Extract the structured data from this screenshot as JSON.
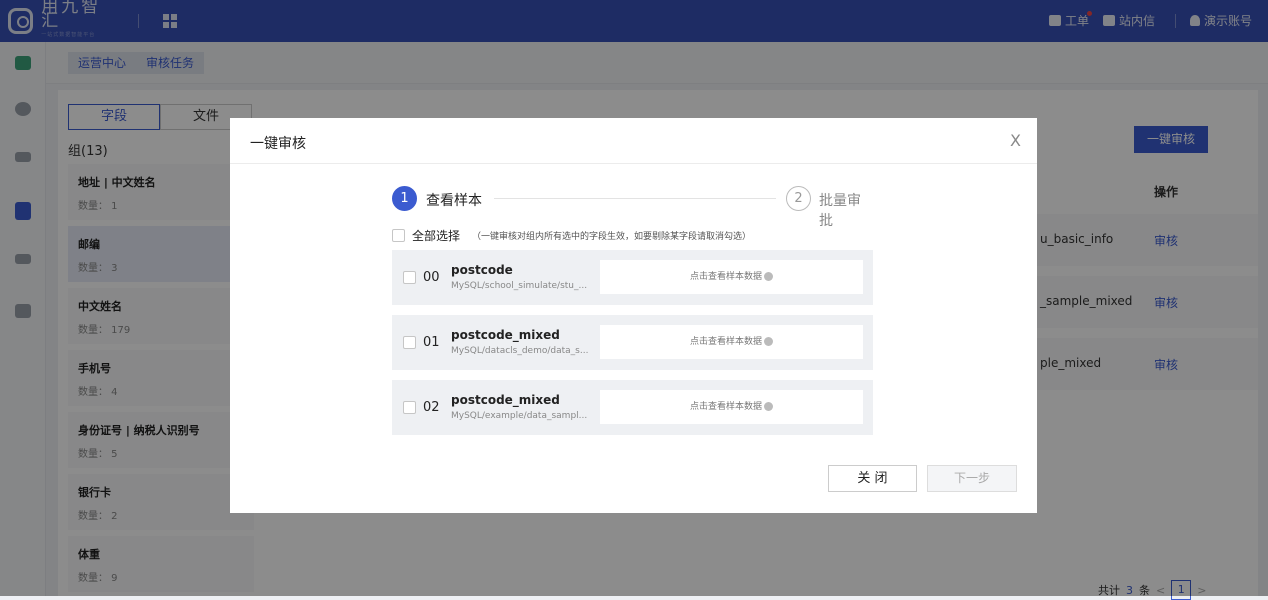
{
  "topbar": {
    "logo_name": "用九智汇",
    "logo_sub": "一站式数据智能平台",
    "ticket_label": "工单",
    "message_label": "站内信",
    "account_label": "演示账号"
  },
  "breadcrumb": [
    "运营中心",
    "审核任务"
  ],
  "tabs": [
    "字段",
    "文件"
  ],
  "group_title": "组(13)",
  "groups": [
    {
      "name": "地址 | 中文姓名",
      "count": "数量： 1"
    },
    {
      "name": "邮编",
      "count": "数量： 3"
    },
    {
      "name": "中文姓名",
      "count": "数量： 179"
    },
    {
      "name": "手机号",
      "count": "数量： 4"
    },
    {
      "name": "身份证号 | 纳税人识别号",
      "count": "数量： 5"
    },
    {
      "name": "银行卡",
      "count": "数量： 2"
    },
    {
      "name": "体重",
      "count": "数量： 9"
    }
  ],
  "main": {
    "one_click_button": "一键审核",
    "op_header": "操作",
    "rows": [
      {
        "name": "u_basic_info",
        "op": "审核"
      },
      {
        "name": "_sample_mixed",
        "op": "审核"
      },
      {
        "name": "ple_mixed",
        "op": "审核"
      }
    ],
    "pager": {
      "prefix": "共计",
      "total": "3",
      "suffix": "条",
      "page": "1"
    }
  },
  "modal": {
    "title": "一键审核",
    "close_symbol": "X",
    "steps": [
      {
        "num": "1",
        "label": "查看样本"
      },
      {
        "num": "2",
        "label": "批量审批"
      }
    ],
    "select_all_label": "全部选择",
    "select_all_hint": "（一键审核对组内所有选中的字段生效，如要剔除某字段请取消勾选）",
    "items": [
      {
        "idx": "00",
        "name": "postcode",
        "path": "MySQL/school_simulate/stu_...",
        "sample": "点击查看样本数据"
      },
      {
        "idx": "01",
        "name": "postcode_mixed",
        "path": "MySQL/datacls_demo/data_s...",
        "sample": "点击查看样本数据"
      },
      {
        "idx": "02",
        "name": "postcode_mixed",
        "path": "MySQL/example/data_sampl...",
        "sample": "点击查看样本数据"
      }
    ],
    "close_button": "关 闭",
    "next_button": "下一步"
  },
  "colors": {
    "primary": "#3b5bd0",
    "topbar": "#3750b6"
  }
}
